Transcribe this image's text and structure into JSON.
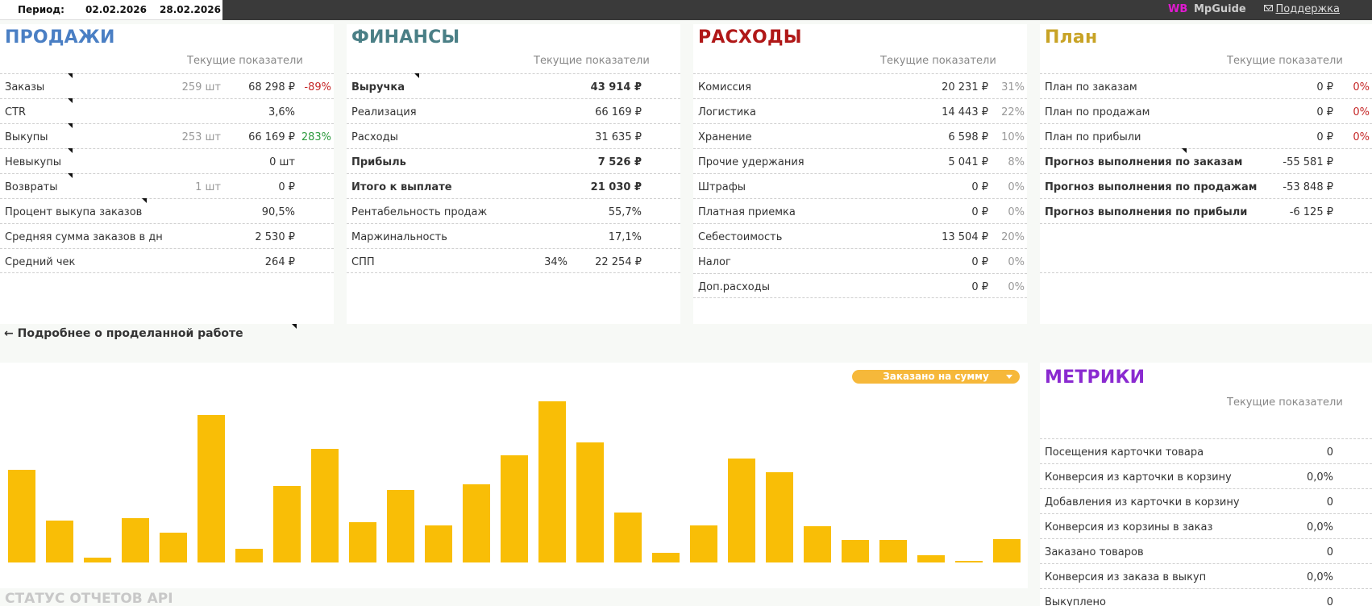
{
  "topbar": {
    "period_label": "Период:",
    "date_from": "02.02.2026",
    "date_to": "28.02.2026",
    "brand_wb": "WB",
    "brand_name": "MpGuide",
    "support": "Поддержка"
  },
  "colors": {
    "sales": "#4a7fc4",
    "finance": "#4a7f86",
    "expenses": "#b01818",
    "plan": "#c8a326",
    "metrics": "#8a2ad0",
    "bar": "#f9be06"
  },
  "sales": {
    "title": "ПРОДАЖИ",
    "subtitle": "Текущие показатели",
    "rows": [
      {
        "label": "Заказы",
        "qty": "259 шт",
        "value": "68 298 ₽",
        "pct": "-89%"
      },
      {
        "label": "CTR",
        "qty": "",
        "value": "3,6%",
        "pct": ""
      },
      {
        "label": "Выкупы",
        "qty": "253 шт",
        "value": "66 169 ₽",
        "pct": "283%"
      },
      {
        "label": "Невыкупы",
        "qty": "",
        "value": "0 шт",
        "pct": ""
      },
      {
        "label": "Возвраты",
        "qty": "1 шт",
        "value": "0 ₽",
        "pct": ""
      },
      {
        "label": "Процент выкупа заказов",
        "qty": "",
        "value": "90,5%",
        "pct": ""
      },
      {
        "label": "Средняя сумма заказов в дн",
        "qty": "",
        "value": "2 530 ₽",
        "pct": ""
      },
      {
        "label": "Средний чек",
        "qty": "",
        "value": "264 ₽",
        "pct": ""
      }
    ]
  },
  "finance": {
    "title": "ФИНАНСЫ",
    "subtitle": "Текущие показатели",
    "rows": [
      {
        "label": "Выручка",
        "extra": "",
        "value": "43 914 ₽"
      },
      {
        "label": "Реализация",
        "extra": "",
        "value": "66 169 ₽"
      },
      {
        "label": "Расходы",
        "extra": "",
        "value": "31 635 ₽"
      },
      {
        "label": "Прибыль",
        "extra": "",
        "value": "7 526 ₽"
      },
      {
        "label": "Итого к выплате",
        "extra": "",
        "value": "21 030 ₽"
      },
      {
        "label": "Рентабельность продаж",
        "extra": "",
        "value": "55,7%"
      },
      {
        "label": "Маржинальность",
        "extra": "",
        "value": "17,1%"
      },
      {
        "label": "СПП",
        "extra": "34%",
        "value": "22 254 ₽"
      }
    ]
  },
  "expenses": {
    "title": "РАСХОДЫ",
    "subtitle": "Текущие показатели",
    "rows": [
      {
        "label": "Комиссия",
        "value": "20 231 ₽",
        "pct": "31%"
      },
      {
        "label": "Логистика",
        "value": "14 443 ₽",
        "pct": "22%"
      },
      {
        "label": "Хранение",
        "value": "6 598 ₽",
        "pct": "10%"
      },
      {
        "label": "Прочие удержания",
        "value": "5 041 ₽",
        "pct": "8%"
      },
      {
        "label": "Штрафы",
        "value": "0 ₽",
        "pct": "0%"
      },
      {
        "label": "Платная приемка",
        "value": "0 ₽",
        "pct": "0%"
      },
      {
        "label": "Себестоимость",
        "value": "13 504 ₽",
        "pct": "20%"
      },
      {
        "label": "Налог",
        "value": "0 ₽",
        "pct": "0%"
      },
      {
        "label": "Доп.расходы",
        "value": "0 ₽",
        "pct": "0%"
      }
    ]
  },
  "plan": {
    "title": "План",
    "subtitle": "Текущие показатели",
    "rows": [
      {
        "label": "План по заказам",
        "value": "0 ₽",
        "pct": "0%"
      },
      {
        "label": "План по продажам",
        "value": "0 ₽",
        "pct": "0%"
      },
      {
        "label": "План по прибыли",
        "value": "0 ₽",
        "pct": "0%"
      },
      {
        "label": "Прогноз выполнения по заказам",
        "value": "-55 581 ₽",
        "pct": ""
      },
      {
        "label": "Прогноз выполнения по продажам",
        "value": "-53 848 ₽",
        "pct": ""
      },
      {
        "label": "Прогноз выполнения по прибыли",
        "value": "-6 125 ₽",
        "pct": ""
      }
    ]
  },
  "back_link": "← Подробнее о проделанной работе",
  "chart": {
    "dropdown": "Заказано на сумму"
  },
  "chart_data": {
    "type": "bar",
    "title": "",
    "xlabel": "",
    "ylabel": "",
    "values": [
      6900,
      3150,
      350,
      3300,
      2200,
      11000,
      1000,
      5750,
      8500,
      3000,
      5400,
      2800,
      5850,
      8000,
      12050,
      8950,
      3750,
      750,
      2750,
      7800,
      6750,
      2700,
      1700,
      1700,
      550,
      100,
      1750
    ]
  },
  "metrics": {
    "title": "МЕТРИКИ",
    "subtitle": "Текущие показатели",
    "rows": [
      {
        "label": "Посещения карточки товара",
        "value": "0"
      },
      {
        "label": "Конверсия из карточки в корзину",
        "value": "0,0%"
      },
      {
        "label": "Добавления из карточки в корзину",
        "value": "0"
      },
      {
        "label": "Конверсия из корзины в заказ",
        "value": "0,0%"
      },
      {
        "label": "Заказано товаров",
        "value": "0"
      },
      {
        "label": "Конверсия из заказа в выкуп",
        "value": "0,0%"
      },
      {
        "label": "Выкуплено",
        "value": "0"
      }
    ]
  },
  "status_title": "СТАТУС ОТЧЕТОВ API"
}
